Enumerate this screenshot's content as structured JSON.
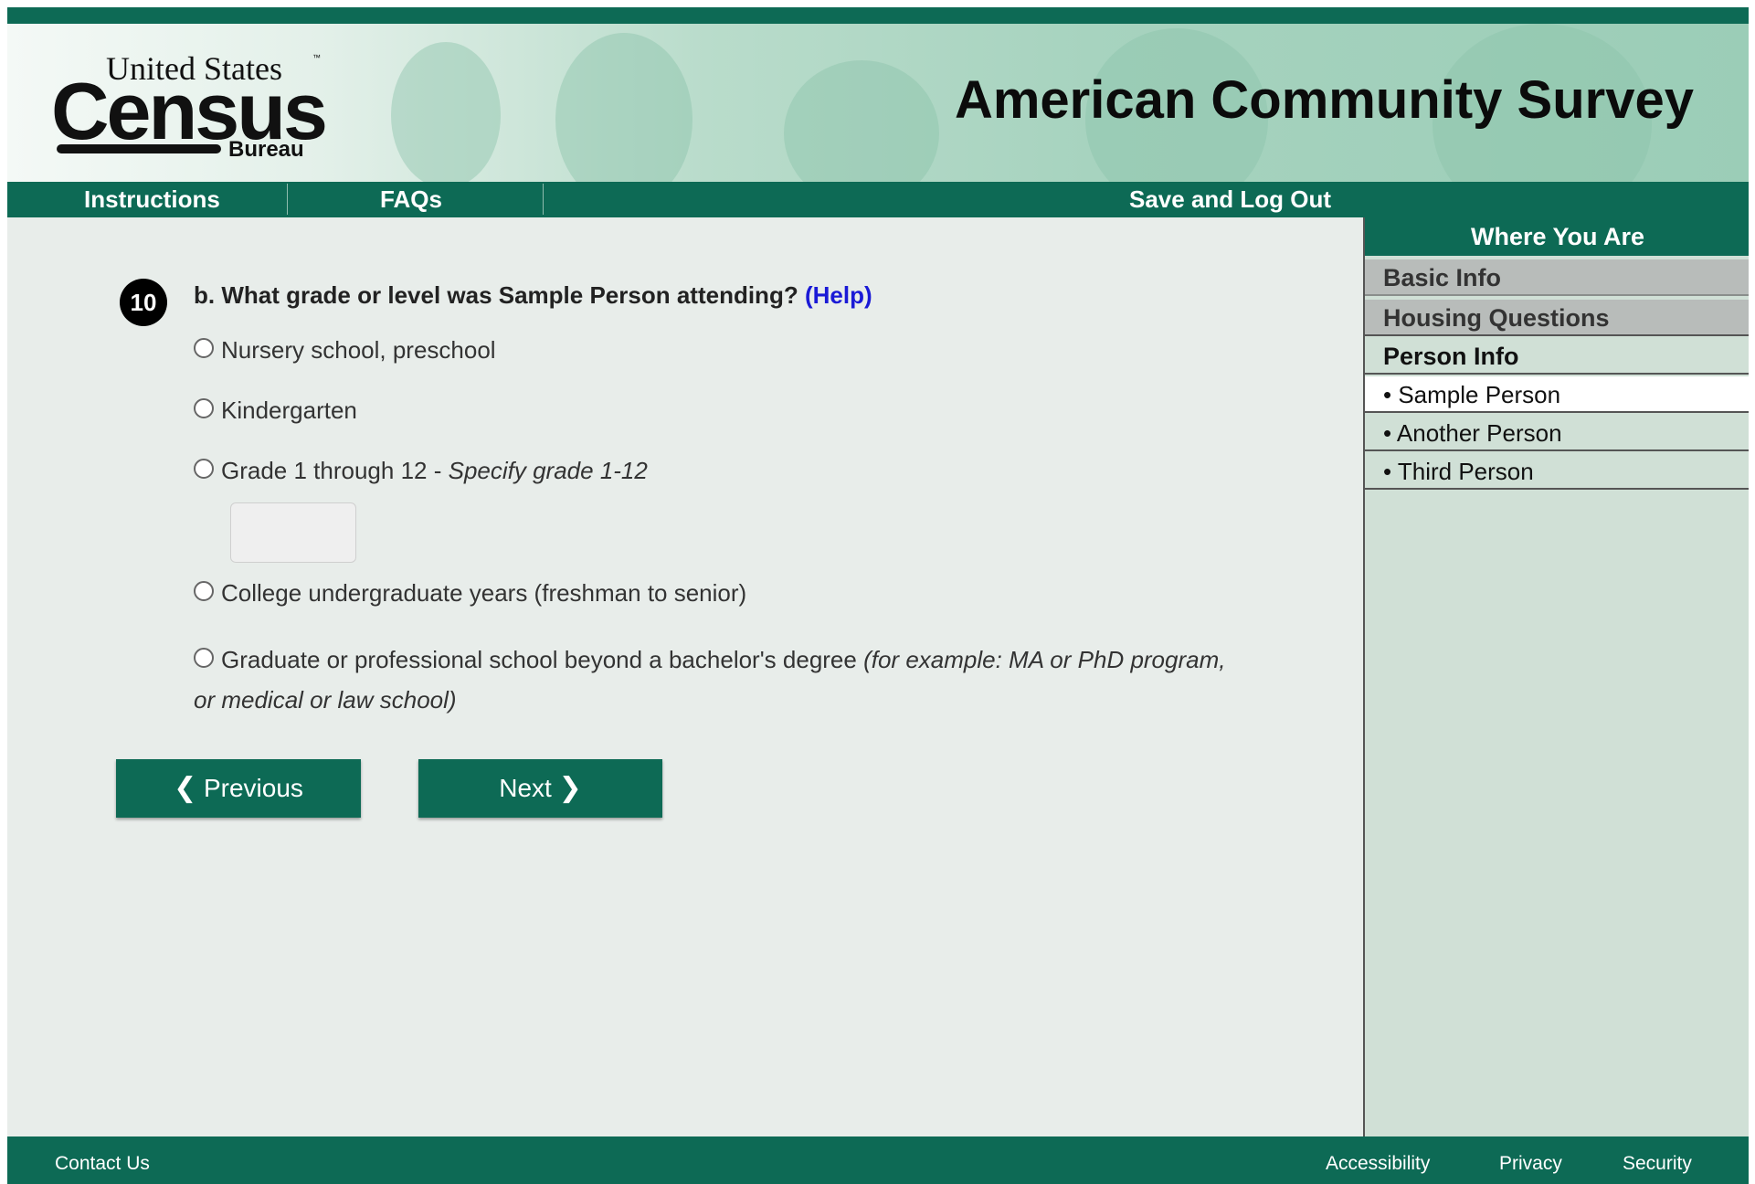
{
  "colors": {
    "brand_green": "#0d6a55",
    "page_bg": "#e8edea",
    "sidebar_bg": "#d0e0d6",
    "help_link": "#1a1ad6"
  },
  "header": {
    "logo": {
      "line1": "United States",
      "trademark": "™",
      "main": "Census",
      "sub": "Bureau"
    },
    "title": "American Community Survey"
  },
  "nav": {
    "instructions": "Instructions",
    "faqs": "FAQs",
    "save_logout": "Save and Log Out"
  },
  "question": {
    "number": "10",
    "text": "b. What grade or level was Sample Person attending?",
    "help_label": "(Help)",
    "options": [
      {
        "label": "Nursery school, preschool",
        "note": ""
      },
      {
        "label": "Kindergarten",
        "note": ""
      },
      {
        "label": "Grade 1 through 12 - ",
        "note": "Specify grade 1-12"
      },
      {
        "label": "College undergraduate years (freshman to senior)",
        "note": ""
      },
      {
        "label": "Graduate or professional school beyond a bachelor's degree ",
        "note": "(for example: MA or PhD program, or medical or law school)"
      }
    ],
    "grade_value": ""
  },
  "buttons": {
    "previous": "Previous",
    "next": "Next"
  },
  "sidebar": {
    "title": "Where You Are",
    "sections": [
      "Basic Info",
      "Housing Questions",
      "Person Info"
    ],
    "persons": [
      "• Sample Person",
      "• Another Person",
      "• Third Person"
    ],
    "current_person_index": 0
  },
  "footer": {
    "contact": "Contact Us",
    "accessibility": "Accessibility",
    "privacy": "Privacy",
    "security": "Security"
  }
}
